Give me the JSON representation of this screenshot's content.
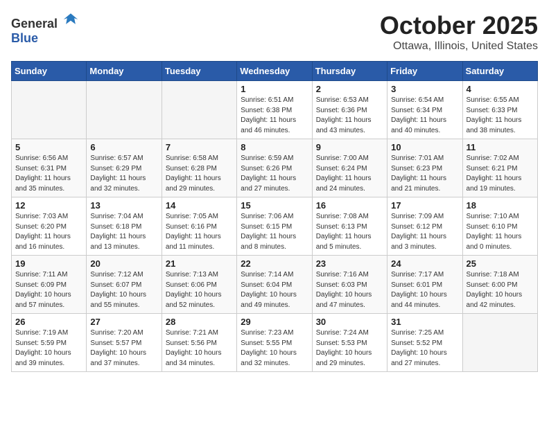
{
  "logo": {
    "general": "General",
    "blue": "Blue"
  },
  "header": {
    "month": "October 2025",
    "location": "Ottawa, Illinois, United States"
  },
  "weekdays": [
    "Sunday",
    "Monday",
    "Tuesday",
    "Wednesday",
    "Thursday",
    "Friday",
    "Saturday"
  ],
  "weeks": [
    [
      {
        "day": "",
        "info": ""
      },
      {
        "day": "",
        "info": ""
      },
      {
        "day": "",
        "info": ""
      },
      {
        "day": "1",
        "info": "Sunrise: 6:51 AM\nSunset: 6:38 PM\nDaylight: 11 hours\nand 46 minutes."
      },
      {
        "day": "2",
        "info": "Sunrise: 6:53 AM\nSunset: 6:36 PM\nDaylight: 11 hours\nand 43 minutes."
      },
      {
        "day": "3",
        "info": "Sunrise: 6:54 AM\nSunset: 6:34 PM\nDaylight: 11 hours\nand 40 minutes."
      },
      {
        "day": "4",
        "info": "Sunrise: 6:55 AM\nSunset: 6:33 PM\nDaylight: 11 hours\nand 38 minutes."
      }
    ],
    [
      {
        "day": "5",
        "info": "Sunrise: 6:56 AM\nSunset: 6:31 PM\nDaylight: 11 hours\nand 35 minutes."
      },
      {
        "day": "6",
        "info": "Sunrise: 6:57 AM\nSunset: 6:29 PM\nDaylight: 11 hours\nand 32 minutes."
      },
      {
        "day": "7",
        "info": "Sunrise: 6:58 AM\nSunset: 6:28 PM\nDaylight: 11 hours\nand 29 minutes."
      },
      {
        "day": "8",
        "info": "Sunrise: 6:59 AM\nSunset: 6:26 PM\nDaylight: 11 hours\nand 27 minutes."
      },
      {
        "day": "9",
        "info": "Sunrise: 7:00 AM\nSunset: 6:24 PM\nDaylight: 11 hours\nand 24 minutes."
      },
      {
        "day": "10",
        "info": "Sunrise: 7:01 AM\nSunset: 6:23 PM\nDaylight: 11 hours\nand 21 minutes."
      },
      {
        "day": "11",
        "info": "Sunrise: 7:02 AM\nSunset: 6:21 PM\nDaylight: 11 hours\nand 19 minutes."
      }
    ],
    [
      {
        "day": "12",
        "info": "Sunrise: 7:03 AM\nSunset: 6:20 PM\nDaylight: 11 hours\nand 16 minutes."
      },
      {
        "day": "13",
        "info": "Sunrise: 7:04 AM\nSunset: 6:18 PM\nDaylight: 11 hours\nand 13 minutes."
      },
      {
        "day": "14",
        "info": "Sunrise: 7:05 AM\nSunset: 6:16 PM\nDaylight: 11 hours\nand 11 minutes."
      },
      {
        "day": "15",
        "info": "Sunrise: 7:06 AM\nSunset: 6:15 PM\nDaylight: 11 hours\nand 8 minutes."
      },
      {
        "day": "16",
        "info": "Sunrise: 7:08 AM\nSunset: 6:13 PM\nDaylight: 11 hours\nand 5 minutes."
      },
      {
        "day": "17",
        "info": "Sunrise: 7:09 AM\nSunset: 6:12 PM\nDaylight: 11 hours\nand 3 minutes."
      },
      {
        "day": "18",
        "info": "Sunrise: 7:10 AM\nSunset: 6:10 PM\nDaylight: 11 hours\nand 0 minutes."
      }
    ],
    [
      {
        "day": "19",
        "info": "Sunrise: 7:11 AM\nSunset: 6:09 PM\nDaylight: 10 hours\nand 57 minutes."
      },
      {
        "day": "20",
        "info": "Sunrise: 7:12 AM\nSunset: 6:07 PM\nDaylight: 10 hours\nand 55 minutes."
      },
      {
        "day": "21",
        "info": "Sunrise: 7:13 AM\nSunset: 6:06 PM\nDaylight: 10 hours\nand 52 minutes."
      },
      {
        "day": "22",
        "info": "Sunrise: 7:14 AM\nSunset: 6:04 PM\nDaylight: 10 hours\nand 49 minutes."
      },
      {
        "day": "23",
        "info": "Sunrise: 7:16 AM\nSunset: 6:03 PM\nDaylight: 10 hours\nand 47 minutes."
      },
      {
        "day": "24",
        "info": "Sunrise: 7:17 AM\nSunset: 6:01 PM\nDaylight: 10 hours\nand 44 minutes."
      },
      {
        "day": "25",
        "info": "Sunrise: 7:18 AM\nSunset: 6:00 PM\nDaylight: 10 hours\nand 42 minutes."
      }
    ],
    [
      {
        "day": "26",
        "info": "Sunrise: 7:19 AM\nSunset: 5:59 PM\nDaylight: 10 hours\nand 39 minutes."
      },
      {
        "day": "27",
        "info": "Sunrise: 7:20 AM\nSunset: 5:57 PM\nDaylight: 10 hours\nand 37 minutes."
      },
      {
        "day": "28",
        "info": "Sunrise: 7:21 AM\nSunset: 5:56 PM\nDaylight: 10 hours\nand 34 minutes."
      },
      {
        "day": "29",
        "info": "Sunrise: 7:23 AM\nSunset: 5:55 PM\nDaylight: 10 hours\nand 32 minutes."
      },
      {
        "day": "30",
        "info": "Sunrise: 7:24 AM\nSunset: 5:53 PM\nDaylight: 10 hours\nand 29 minutes."
      },
      {
        "day": "31",
        "info": "Sunrise: 7:25 AM\nSunset: 5:52 PM\nDaylight: 10 hours\nand 27 minutes."
      },
      {
        "day": "",
        "info": ""
      }
    ]
  ]
}
